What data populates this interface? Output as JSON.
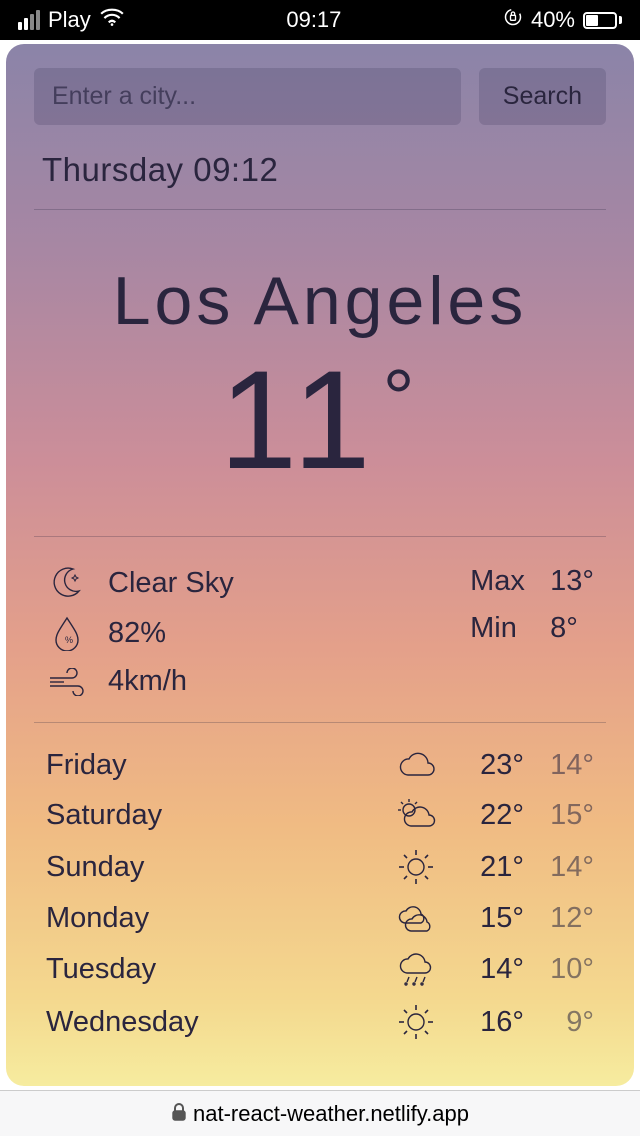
{
  "status": {
    "carrier": "Play",
    "time": "09:17",
    "battery": "40%"
  },
  "search": {
    "placeholder": "Enter a city...",
    "button": "Search"
  },
  "datetime": "Thursday 09:12",
  "city": "Los Angeles",
  "current_temp": "11",
  "details": {
    "condition": "Clear Sky",
    "humidity": "82%",
    "wind": "4km/h",
    "max_label": "Max",
    "max": "13°",
    "min_label": "Min",
    "min": "8°"
  },
  "forecast": [
    {
      "day": "Friday",
      "icon": "cloud",
      "hi": "23°",
      "lo": "14°"
    },
    {
      "day": "Saturday",
      "icon": "partly-cloudy",
      "hi": "22°",
      "lo": "15°"
    },
    {
      "day": "Sunday",
      "icon": "sun",
      "hi": "21°",
      "lo": "14°"
    },
    {
      "day": "Monday",
      "icon": "cloudy",
      "hi": "15°",
      "lo": "12°"
    },
    {
      "day": "Tuesday",
      "icon": "rain",
      "hi": "14°",
      "lo": "10°"
    },
    {
      "day": "Wednesday",
      "icon": "sun",
      "hi": "16°",
      "lo": "9°"
    }
  ],
  "url": "nat-react-weather.netlify.app"
}
